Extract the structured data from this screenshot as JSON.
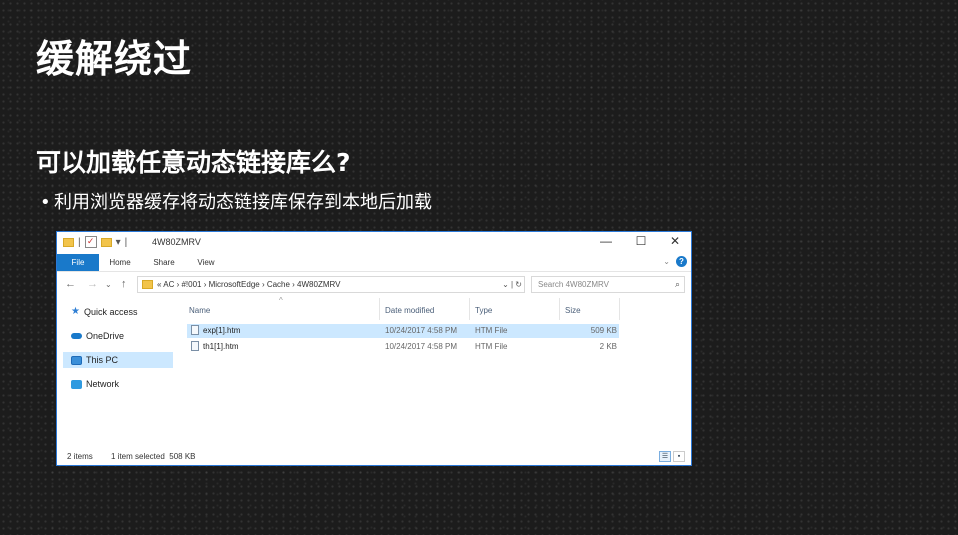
{
  "slide": {
    "title": "缓解绕过",
    "subtitle": "可以加载任意动态链接库么?",
    "bullet": "利用浏览器缓存将动态链接库保存到本地后加载"
  },
  "explorer": {
    "title": "4W80ZMRV",
    "controls": {
      "minimize": "—",
      "maximize": "☐",
      "close": "✕"
    },
    "ribbon_tabs": [
      "File",
      "Home",
      "Share",
      "View"
    ],
    "address": {
      "path": "« AC › #!001 › MicrosoftEdge › Cache › 4W80ZMRV",
      "dropdown": "⌄",
      "refresh": "↻"
    },
    "search": {
      "placeholder": "Search 4W80ZMRV",
      "icon": "search-icon"
    },
    "nav_buttons": {
      "back": "←",
      "forward": "→",
      "recent": "⌄",
      "up": "↑"
    },
    "sidebar": [
      {
        "label": "Quick access",
        "icon": "star-icon"
      },
      {
        "label": "OneDrive",
        "icon": "cloud-icon"
      },
      {
        "label": "This PC",
        "icon": "computer-icon",
        "selected": true
      },
      {
        "label": "Network",
        "icon": "network-icon"
      }
    ],
    "columns": [
      "Name",
      "Date modified",
      "Type",
      "Size"
    ],
    "files": [
      {
        "name": "exp[1].htm",
        "date": "10/24/2017 4:58 PM",
        "type": "HTM File",
        "size": "509 KB",
        "selected": true
      },
      {
        "name": "th1[1].htm",
        "date": "10/24/2017 4:58 PM",
        "type": "HTM File",
        "size": "2 KB",
        "selected": false
      }
    ],
    "status": {
      "items": "2 items",
      "selected": "1 item selected  508 KB"
    },
    "colors": {
      "accent": "#1979ca",
      "selection": "#cce8ff",
      "window_border": "#2b79d8"
    }
  }
}
